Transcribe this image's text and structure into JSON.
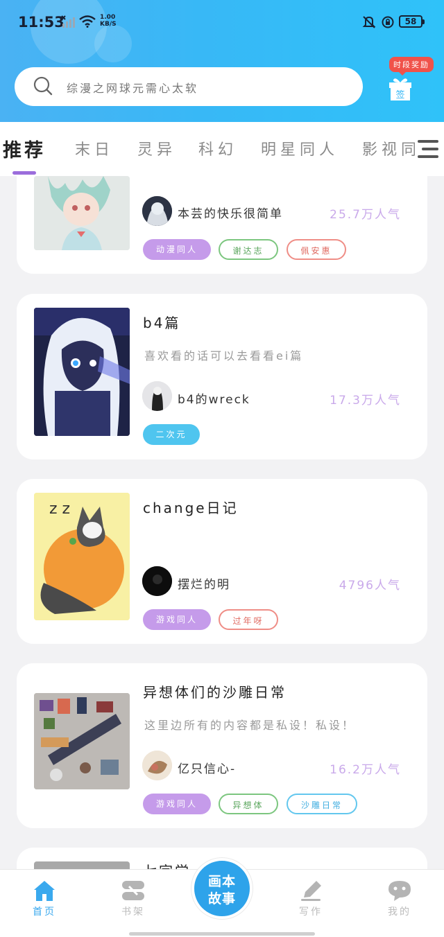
{
  "status_bar": {
    "time": "11:53",
    "net_speed_value": "1.00",
    "net_speed_unit": "KB/S",
    "battery": "58",
    "icons": [
      "signal-icon",
      "wifi-icon",
      "mute-bell-icon",
      "rotation-lock-icon",
      "battery-icon"
    ]
  },
  "header": {
    "search_placeholder": "综漫之网球元需心太软",
    "reward_badge": "时段奖励",
    "gift_label": "签"
  },
  "tabs": [
    {
      "label": "推荐",
      "active": true
    },
    {
      "label": "末日"
    },
    {
      "label": "灵异"
    },
    {
      "label": "科幻"
    },
    {
      "label": "明星同人"
    },
    {
      "label": "影视同"
    }
  ],
  "cards": [
    {
      "title": "",
      "description": "",
      "author": "本芸的快乐很简单",
      "popularity": "25.7万人气",
      "tags": [
        "动漫同人",
        "谢达志",
        "佩安惠"
      ]
    },
    {
      "title": "b4篇",
      "description": "喜欢看的话可以去看看ei篇",
      "author": "b4的wreck",
      "popularity": "17.3万人气",
      "tags": [
        "二次元"
      ]
    },
    {
      "title": "change日记",
      "description": "",
      "author": "摆烂的明",
      "popularity": "4796人气",
      "tags": [
        "游戏同人",
        "过年呀"
      ]
    },
    {
      "title": "异想体们的沙雕日常",
      "description": "这里边所有的内容都是私设！私设！",
      "author": "亿只信心-",
      "popularity": "16.2万人气",
      "tags": [
        "游戏同人",
        "异想体",
        "沙雕日常"
      ]
    },
    {
      "title": "七宗学",
      "description": "",
      "author": "",
      "popularity": "",
      "tags": []
    }
  ],
  "bottom_nav": {
    "items": [
      {
        "label": "首页",
        "icon": "home-icon",
        "active": true
      },
      {
        "label": "书架",
        "icon": "bookshelf-icon"
      },
      {
        "label": "写作",
        "icon": "pen-icon"
      },
      {
        "label": "我的",
        "icon": "chat-profile-icon"
      }
    ],
    "center_line1": "画本",
    "center_line2": "故事"
  },
  "colors": {
    "header_blue": "#38b8f6",
    "accent_purple": "#9b6ddc",
    "popularity_purple": "#c9a9ea",
    "nav_active": "#39a8ee"
  }
}
